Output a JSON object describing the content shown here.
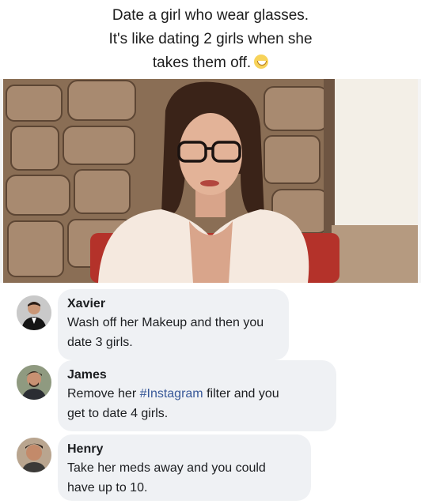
{
  "caption": {
    "line1": "Date a girl who wear glasses.",
    "line2": "It's like dating 2 girls when she",
    "line3": "takes them off.",
    "emoji_icon": "grinning-face-emoji"
  },
  "photo": {
    "subject": "woman-with-glasses-photo"
  },
  "comments": [
    {
      "name": "Xavier",
      "text_line1": "Wash off her Makeup and then you",
      "text_line2": "date 3 girls."
    },
    {
      "name": "James",
      "text_pre": "Remove her ",
      "hashtag": "#Instagram",
      "text_post": " filter and you",
      "text_line2": "get to date 4 girls."
    },
    {
      "name": "Henry",
      "text_line1": "Take her meds away and you could",
      "text_line2": "have up to 10."
    }
  ],
  "colors": {
    "bubble": "#eff1f4",
    "hashtag": "#385898",
    "text": "#1c1e21"
  }
}
